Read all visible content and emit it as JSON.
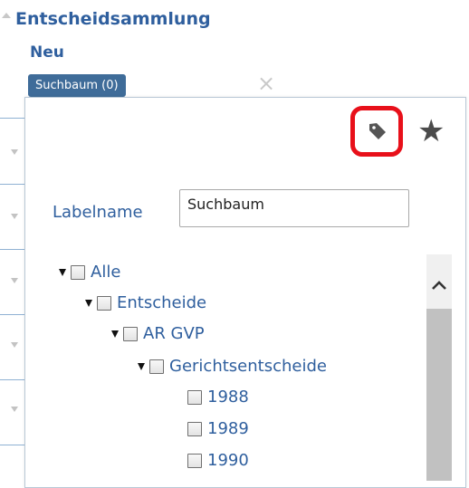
{
  "header": {
    "section_title": "Entscheidsammlung",
    "new_link": "Neu",
    "active_tag": "Suchbaum (0)",
    "close_glyph": "×"
  },
  "popup": {
    "label_button_icon": "tag-icon",
    "favorite_icon": "star-icon",
    "favorite_glyph": "★",
    "label_field": {
      "label": "Labelname",
      "value": "Suchbaum"
    },
    "tree": [
      {
        "label": "Alle",
        "expanded": true
      },
      {
        "label": "Entscheide",
        "expanded": true
      },
      {
        "label": "AR GVP",
        "expanded": true
      },
      {
        "label": "Gerichtsentscheide",
        "expanded": true
      },
      {
        "label": "1988"
      },
      {
        "label": "1989"
      },
      {
        "label": "1990"
      }
    ]
  },
  "colors": {
    "link": "#2f5f9e",
    "tag_chip": "#3f6c99",
    "highlight": "#e8101a"
  }
}
